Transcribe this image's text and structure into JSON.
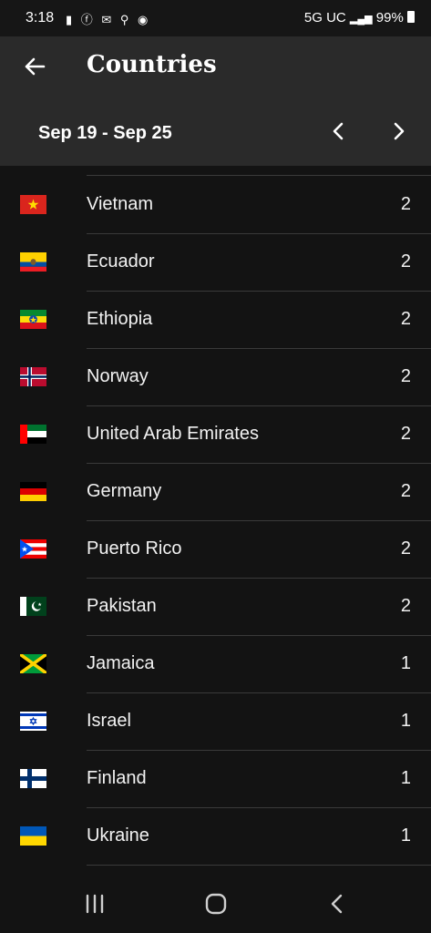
{
  "status": {
    "time": "3:18",
    "left_icons": "▮ ⓕ ✉ ⚲ ◉",
    "network": "5G UC",
    "battery": "99%"
  },
  "appbar": {
    "title": "Countries",
    "back_icon": "arrow-left-icon"
  },
  "period": {
    "range": "Sep 19 - Sep 25"
  },
  "countries": [
    {
      "name": "Vietnam",
      "count": "2",
      "flag": "vietnam"
    },
    {
      "name": "Ecuador",
      "count": "2",
      "flag": "ecuador"
    },
    {
      "name": "Ethiopia",
      "count": "2",
      "flag": "ethiopia"
    },
    {
      "name": "Norway",
      "count": "2",
      "flag": "norway"
    },
    {
      "name": "United Arab Emirates",
      "count": "2",
      "flag": "uae"
    },
    {
      "name": "Germany",
      "count": "2",
      "flag": "germany"
    },
    {
      "name": "Puerto Rico",
      "count": "2",
      "flag": "puerto-rico"
    },
    {
      "name": "Pakistan",
      "count": "2",
      "flag": "pakistan"
    },
    {
      "name": "Jamaica",
      "count": "1",
      "flag": "jamaica"
    },
    {
      "name": "Israel",
      "count": "1",
      "flag": "israel"
    },
    {
      "name": "Finland",
      "count": "1",
      "flag": "finland"
    },
    {
      "name": "Ukraine",
      "count": "1",
      "flag": "ukraine"
    }
  ],
  "colors": {
    "background": "#131313",
    "header": "#2a2a2a",
    "divider": "#3a3a3a",
    "text": "#f2f2f2"
  }
}
